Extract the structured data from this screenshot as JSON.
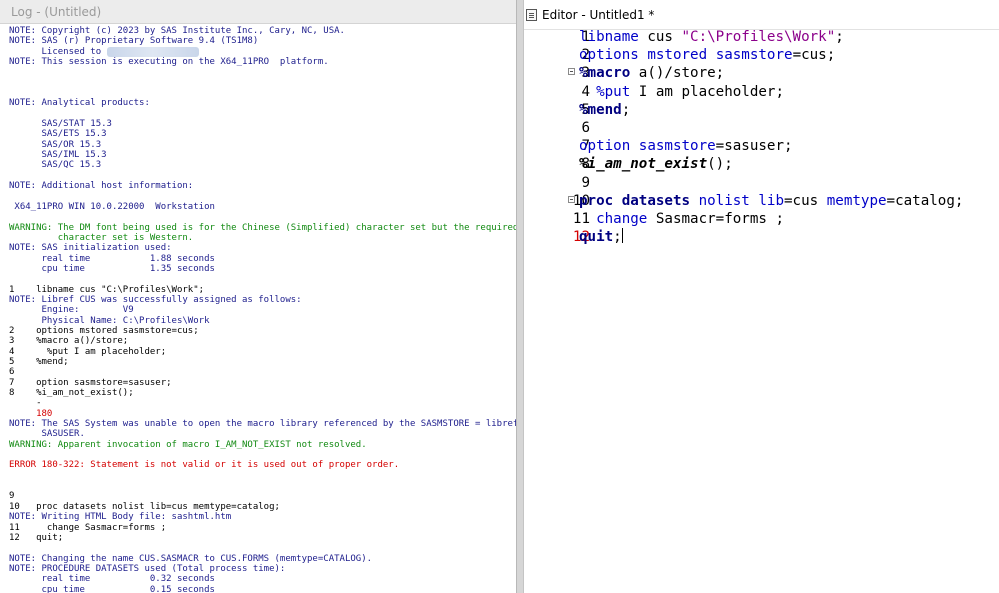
{
  "log": {
    "title": "Log - (Untitled)",
    "lines": [
      {
        "type": "note",
        "text": "NOTE: Copyright (c) 2023 by SAS Institute Inc., Cary, NC, USA."
      },
      {
        "type": "note",
        "text": "NOTE: SAS (r) Proprietary Software 9.4 (TS1M8)"
      },
      {
        "type": "note",
        "text": "      Licensed to "
      },
      {
        "type": "note",
        "text": "NOTE: This session is executing on the X64_11PRO  platform."
      },
      {
        "type": "blank",
        "text": ""
      },
      {
        "type": "blank",
        "text": ""
      },
      {
        "type": "blank",
        "text": ""
      },
      {
        "type": "note",
        "text": "NOTE: Analytical products:"
      },
      {
        "type": "blank",
        "text": ""
      },
      {
        "type": "note",
        "text": "      SAS/STAT 15.3"
      },
      {
        "type": "note",
        "text": "      SAS/ETS 15.3"
      },
      {
        "type": "note",
        "text": "      SAS/OR 15.3"
      },
      {
        "type": "note",
        "text": "      SAS/IML 15.3"
      },
      {
        "type": "note",
        "text": "      SAS/QC 15.3"
      },
      {
        "type": "blank",
        "text": ""
      },
      {
        "type": "note",
        "text": "NOTE: Additional host information:"
      },
      {
        "type": "blank",
        "text": ""
      },
      {
        "type": "note",
        "text": " X64_11PRO WIN 10.0.22000  Workstation"
      },
      {
        "type": "blank",
        "text": ""
      },
      {
        "type": "warn",
        "text": "WARNING: The DM font being used is for the Chinese (Simplified) character set but the required"
      },
      {
        "type": "warn",
        "text": "         character set is Western."
      },
      {
        "type": "note",
        "text": "NOTE: SAS initialization used:"
      },
      {
        "type": "note",
        "text": "      real time           1.88 seconds"
      },
      {
        "type": "note",
        "text": "      cpu time            1.35 seconds"
      },
      {
        "type": "blank",
        "text": ""
      },
      {
        "type": "src",
        "text": "1    libname cus \"C:\\Profiles\\Work\";"
      },
      {
        "type": "note",
        "text": "NOTE: Libref CUS was successfully assigned as follows:"
      },
      {
        "type": "note",
        "text": "      Engine:        V9"
      },
      {
        "type": "note",
        "text": "      Physical Name: C:\\Profiles\\Work"
      },
      {
        "type": "src",
        "text": "2    options mstored sasmstore=cus;"
      },
      {
        "type": "src",
        "text": "3    %macro a()/store;"
      },
      {
        "type": "src",
        "text": "4      %put I am placeholder;"
      },
      {
        "type": "src",
        "text": "5    %mend;"
      },
      {
        "type": "src",
        "text": "6"
      },
      {
        "type": "src",
        "text": "7    option sasmstore=sasuser;"
      },
      {
        "type": "src",
        "text": "8    %i_am_not_exist();"
      },
      {
        "type": "src",
        "text": "     -"
      },
      {
        "type": "err",
        "text": "     180"
      },
      {
        "type": "note",
        "text": "NOTE: The SAS System was unable to open the macro library referenced by the SASMSTORE = libref"
      },
      {
        "type": "note",
        "text": "      SASUSER."
      },
      {
        "type": "warn",
        "text": "WARNING: Apparent invocation of macro I_AM_NOT_EXIST not resolved."
      },
      {
        "type": "blank",
        "text": ""
      },
      {
        "type": "err",
        "text": "ERROR 180-322: Statement is not valid or it is used out of proper order."
      },
      {
        "type": "blank",
        "text": ""
      },
      {
        "type": "blank",
        "text": ""
      },
      {
        "type": "src",
        "text": "9"
      },
      {
        "type": "src",
        "text": "10   proc datasets nolist lib=cus memtype=catalog;"
      },
      {
        "type": "note",
        "text": "NOTE: Writing HTML Body file: sashtml.htm"
      },
      {
        "type": "src",
        "text": "11     change Sasmacr=forms ;"
      },
      {
        "type": "src",
        "text": "12   quit;"
      },
      {
        "type": "blank",
        "text": ""
      },
      {
        "type": "note",
        "text": "NOTE: Changing the name CUS.SASMACR to CUS.FORMS (memtype=CATALOG)."
      },
      {
        "type": "note",
        "text": "NOTE: PROCEDURE DATASETS used (Total process time):"
      },
      {
        "type": "note",
        "text": "      real time           0.32 seconds"
      },
      {
        "type": "note",
        "text": "      cpu time            0.15 seconds"
      }
    ]
  },
  "editor": {
    "title": "Editor - Untitled1 *",
    "current_line": 12,
    "lines": [
      {
        "num": "1",
        "fold": false,
        "tokens": [
          {
            "c": "kw",
            "t": "libname"
          },
          {
            "c": "",
            "t": " cus "
          },
          {
            "c": "str",
            "t": "\"C:\\Profiles\\Work\""
          },
          {
            "c": "",
            "t": ";"
          }
        ]
      },
      {
        "num": "2",
        "fold": false,
        "tokens": [
          {
            "c": "kw",
            "t": "options"
          },
          {
            "c": "",
            "t": " "
          },
          {
            "c": "kw",
            "t": "mstored"
          },
          {
            "c": "",
            "t": " "
          },
          {
            "c": "kw",
            "t": "sasmstore"
          },
          {
            "c": "",
            "t": "=cus;"
          }
        ]
      },
      {
        "num": "3",
        "fold": true,
        "tokens": [
          {
            "c": "kwb",
            "t": "%macro"
          },
          {
            "c": "",
            "t": " a()/store;"
          }
        ]
      },
      {
        "num": "4",
        "fold": false,
        "tokens": [
          {
            "c": "",
            "t": "  "
          },
          {
            "c": "kw",
            "t": "%put"
          },
          {
            "c": "",
            "t": " I am placeholder;"
          }
        ]
      },
      {
        "num": "5",
        "fold": false,
        "tokens": [
          {
            "c": "kwb",
            "t": "%mend"
          },
          {
            "c": "",
            "t": ";"
          }
        ]
      },
      {
        "num": "6",
        "fold": false,
        "tokens": []
      },
      {
        "num": "7",
        "fold": false,
        "tokens": [
          {
            "c": "kw",
            "t": "option"
          },
          {
            "c": "",
            "t": " "
          },
          {
            "c": "kw",
            "t": "sasmstore"
          },
          {
            "c": "",
            "t": "=sasuser;"
          }
        ]
      },
      {
        "num": "8",
        "fold": false,
        "tokens": [
          {
            "c": "macroi",
            "t": "%i_am_not_exist"
          },
          {
            "c": "",
            "t": "();"
          }
        ]
      },
      {
        "num": "9",
        "fold": false,
        "tokens": []
      },
      {
        "num": "10",
        "fold": true,
        "tokens": [
          {
            "c": "kwb",
            "t": "proc datasets"
          },
          {
            "c": "",
            "t": " "
          },
          {
            "c": "kw",
            "t": "nolist"
          },
          {
            "c": "",
            "t": " "
          },
          {
            "c": "kw",
            "t": "lib"
          },
          {
            "c": "",
            "t": "=cus "
          },
          {
            "c": "kw",
            "t": "memtype"
          },
          {
            "c": "",
            "t": "=catalog;"
          }
        ]
      },
      {
        "num": "11",
        "fold": false,
        "tokens": [
          {
            "c": "",
            "t": "  "
          },
          {
            "c": "kw",
            "t": "change"
          },
          {
            "c": "",
            "t": " Sasmacr=forms ;"
          }
        ]
      },
      {
        "num": "12",
        "fold": false,
        "tokens": [
          {
            "c": "kwb",
            "t": "quit"
          },
          {
            "c": "",
            "t": ";"
          }
        ]
      }
    ]
  },
  "colors": {
    "note": "#1d1d8c",
    "warning": "#128a12",
    "error": "#d40000",
    "keyword": "#0000c8",
    "string": "#8b008b"
  }
}
